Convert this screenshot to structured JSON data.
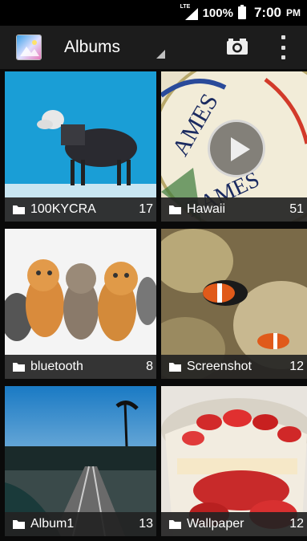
{
  "status_bar": {
    "network": "LTE",
    "battery": "100%",
    "time": "7:00",
    "ampm": "PM",
    "icons": [
      "signal-icon",
      "battery-icon"
    ]
  },
  "action_bar": {
    "title": "Albums",
    "icons": [
      "gallery-app-icon",
      "camera-icon",
      "overflow-menu-icon"
    ]
  },
  "albums": [
    {
      "name": "100KYCRA",
      "count": "17",
      "thumb_desc": "sheep"
    },
    {
      "name": "Hawaii",
      "count": "51",
      "thumb_desc": "video plate"
    },
    {
      "name": "bluetooth",
      "count": "8",
      "thumb_desc": "kittens"
    },
    {
      "name": "Screenshot",
      "count": "12",
      "thumb_desc": "clownfish"
    },
    {
      "name": "Album1",
      "count": "13",
      "thumb_desc": "railroad"
    },
    {
      "name": "Wallpaper",
      "count": "12",
      "thumb_desc": "strawberry dessert"
    }
  ],
  "colors": {
    "action_bar": "#1c1c1c",
    "caption": "#232323",
    "background": "#000000"
  }
}
